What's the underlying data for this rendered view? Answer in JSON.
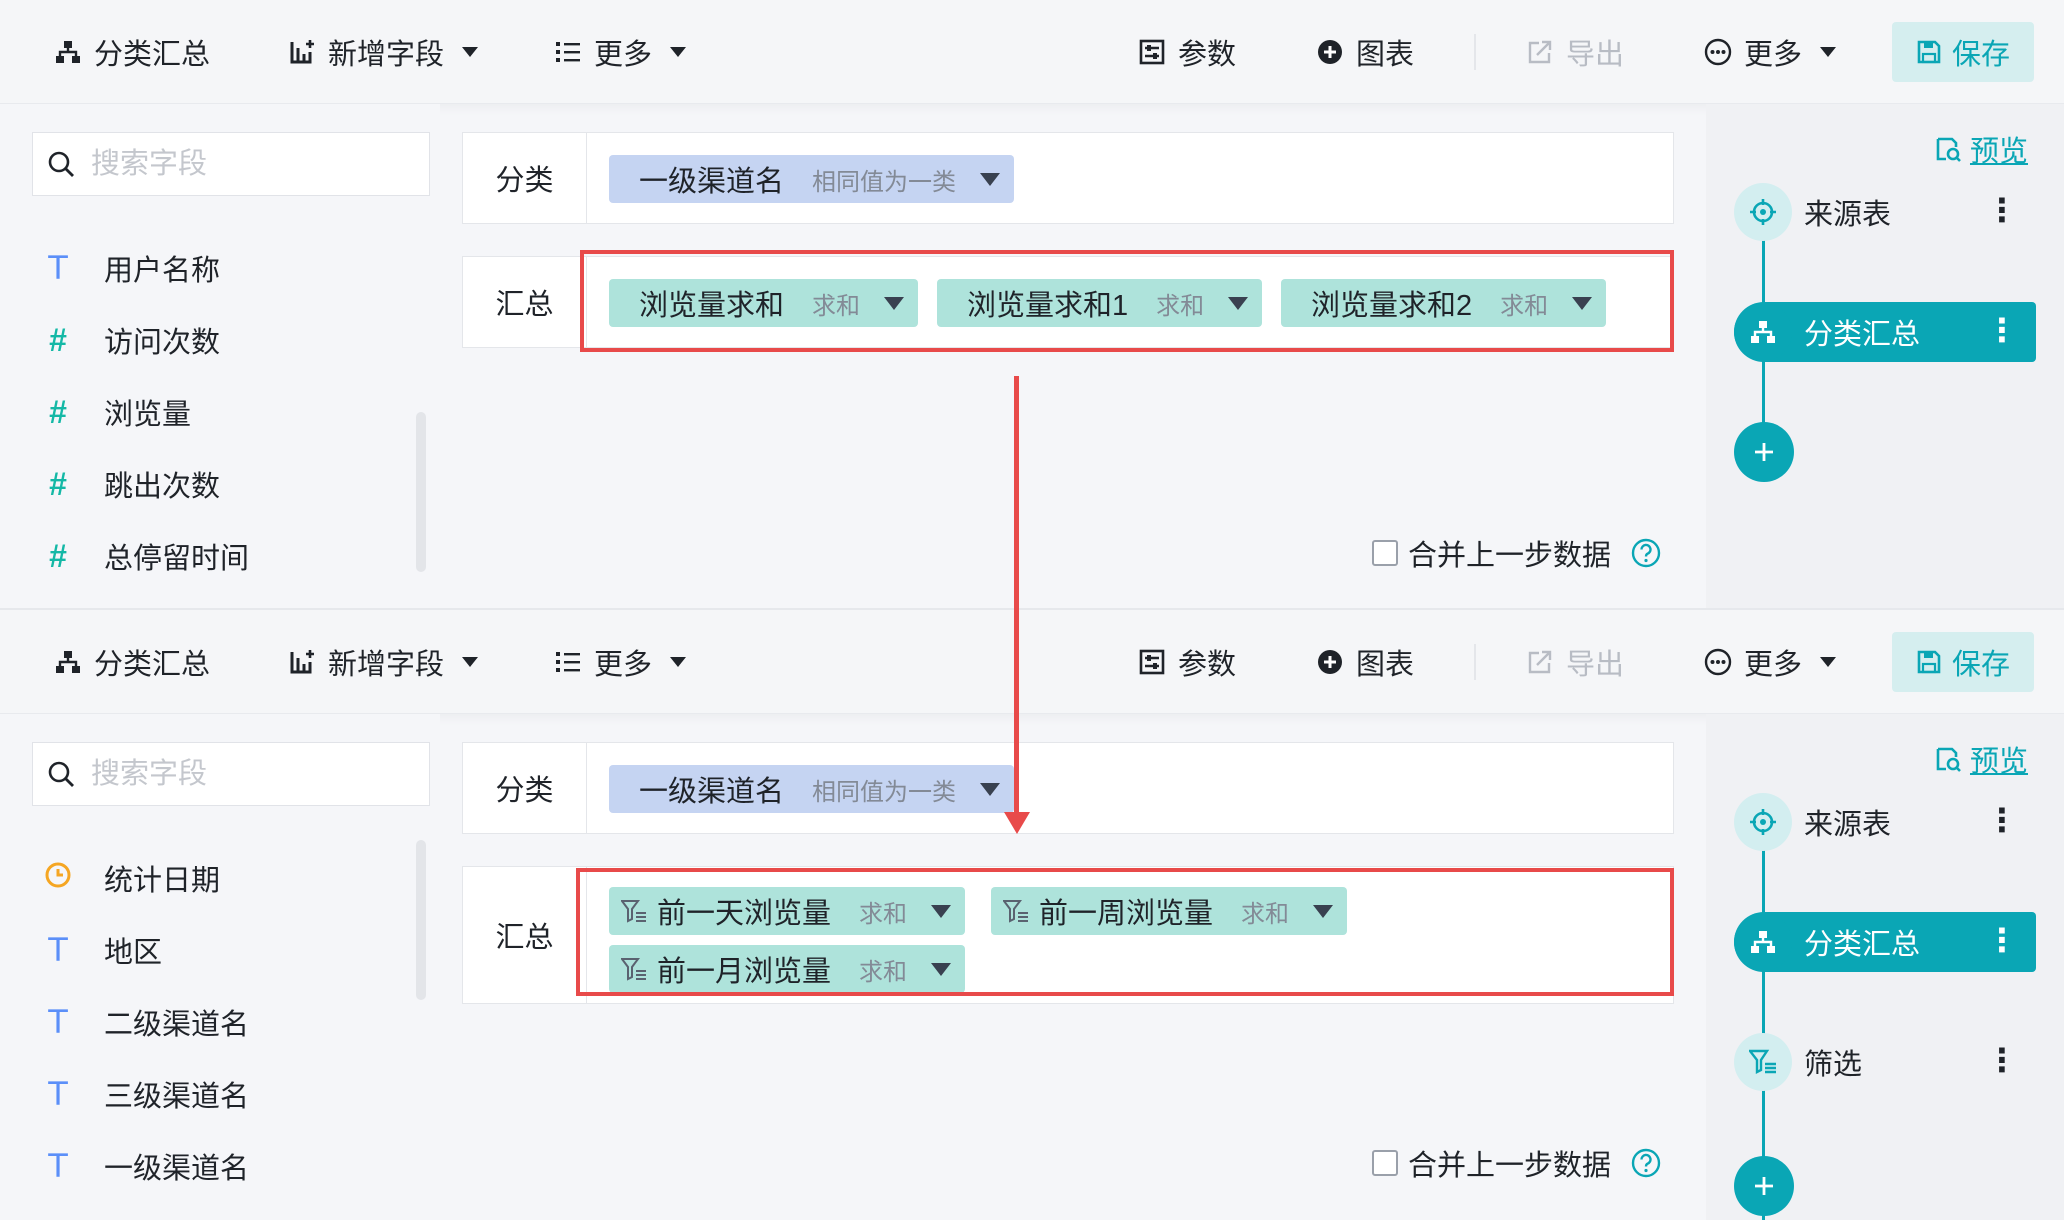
{
  "panels": [
    {
      "toolbar": {
        "group_summary": "分类汇总",
        "add_field": "新增字段",
        "more_left": "更多",
        "params": "参数",
        "chart": "图表",
        "export": "导出",
        "more_right": "更多",
        "save": "保存"
      },
      "search": {
        "placeholder": "搜索字段"
      },
      "fields": [
        {
          "type": "T",
          "label": "用户名称"
        },
        {
          "type": "#",
          "label": "访问次数"
        },
        {
          "type": "#",
          "label": "浏览量"
        },
        {
          "type": "#",
          "label": "跳出次数"
        },
        {
          "type": "#",
          "label": "总停留时间"
        }
      ],
      "category_label": "分类",
      "category_chip": {
        "name": "一级渠道名",
        "mode": "相同值为一类"
      },
      "summary_label": "汇总",
      "summary_chips": [
        {
          "name": "浏览量求和",
          "agg": "求和"
        },
        {
          "name": "浏览量求和1",
          "agg": "求和"
        },
        {
          "name": "浏览量求和2",
          "agg": "求和"
        }
      ],
      "merge_label": "合并上一步数据",
      "preview": "预览",
      "flow": [
        {
          "label": "来源表",
          "icon": "crosshair-icon"
        },
        {
          "label": "分类汇总",
          "icon": "group-icon",
          "active": true
        }
      ]
    },
    {
      "toolbar": {
        "group_summary": "分类汇总",
        "add_field": "新增字段",
        "more_left": "更多",
        "params": "参数",
        "chart": "图表",
        "export": "导出",
        "more_right": "更多",
        "save": "保存"
      },
      "search": {
        "placeholder": "搜索字段"
      },
      "fields": [
        {
          "type": "clock",
          "label": "统计日期"
        },
        {
          "type": "T",
          "label": "地区"
        },
        {
          "type": "T",
          "label": "二级渠道名"
        },
        {
          "type": "T",
          "label": "三级渠道名"
        },
        {
          "type": "T",
          "label": "一级渠道名"
        }
      ],
      "category_label": "分类",
      "category_chip": {
        "name": "一级渠道名",
        "mode": "相同值为一类"
      },
      "summary_label": "汇总",
      "summary_chips": [
        {
          "name": "前一天浏览量",
          "agg": "求和"
        },
        {
          "name": "前一周浏览量",
          "agg": "求和"
        },
        {
          "name": "前一月浏览量",
          "agg": "求和"
        }
      ],
      "merge_label": "合并上一步数据",
      "preview": "预览",
      "flow": [
        {
          "label": "来源表",
          "icon": "crosshair-icon"
        },
        {
          "label": "分类汇总",
          "icon": "group-icon",
          "active": true
        },
        {
          "label": "筛选",
          "icon": "filter-icon"
        }
      ]
    }
  ],
  "colors": {
    "accent": "#0aa6b5",
    "highlight": "#e84a4a",
    "category_chip": "#c5d4f2",
    "summary_chip": "#aee3db"
  }
}
